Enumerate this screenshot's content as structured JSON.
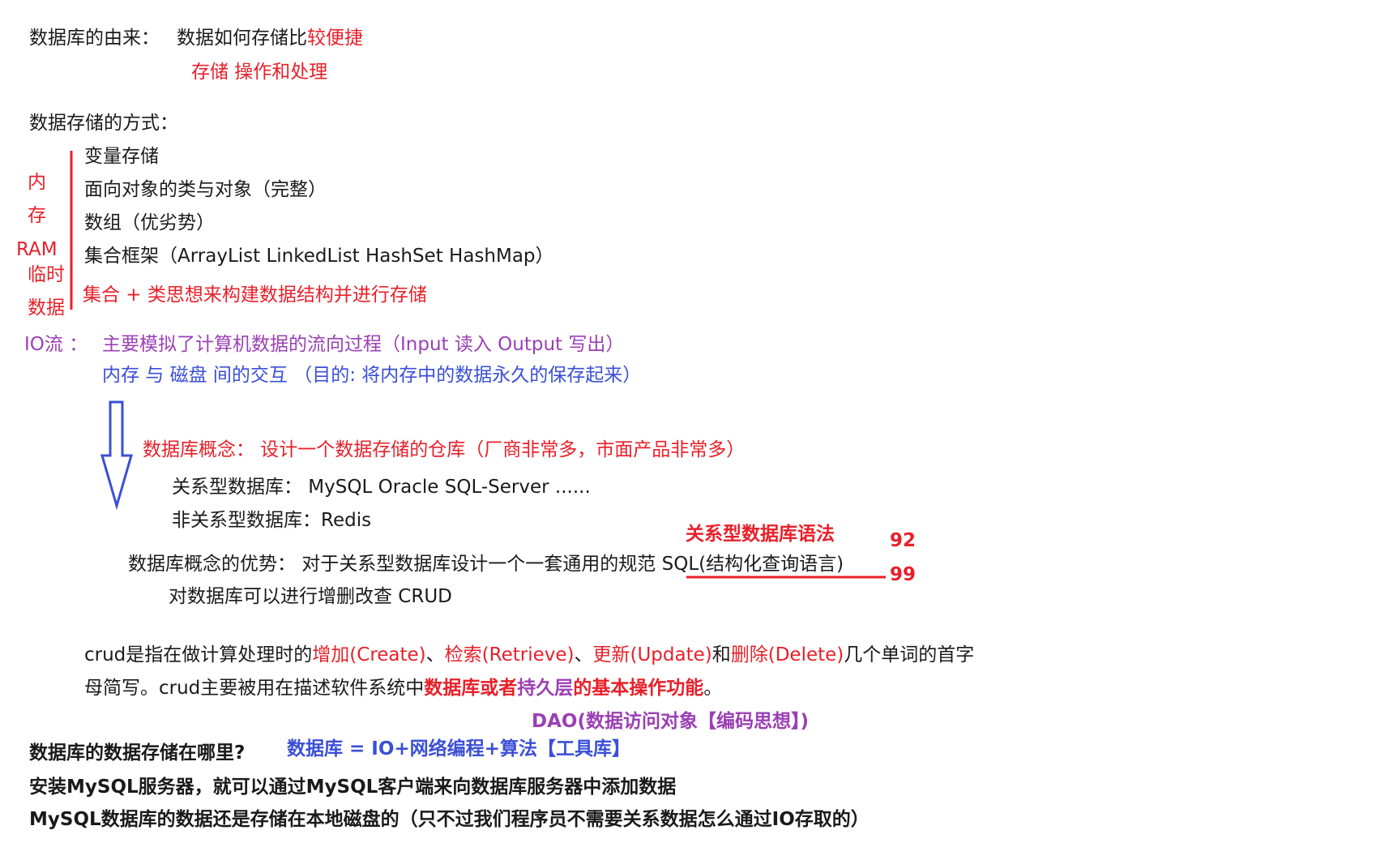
{
  "origin": {
    "label": "数据库的由来：",
    "text_black": "数据如何存储比",
    "text_red": "较便捷",
    "sub": "存储   操作和处理"
  },
  "storage": {
    "heading": "数据存储的方式：",
    "items": [
      "变量存储",
      "面向对象的类与对象（完整）",
      "数组（优劣势）",
      "集合框架（ArrayList LinkedList HashSet HashMap）"
    ],
    "summary": "集合 + 类思想来构建数据结构并进行存储",
    "side_labels": [
      "内",
      "存",
      "RAM",
      "临时",
      "数据"
    ]
  },
  "io": {
    "label": "IO流 ：",
    "line1": "主要模拟了计算机数据的流向过程（Input 读入   Output 写出）",
    "line2": "内存 与  磁盘  间的交互  （目的:   将内存中的数据永久的保存起来）"
  },
  "db_concept": {
    "line": "数据库概念：   设计一个数据存储的仓库（厂商非常多，市面产品非常多）",
    "relational": "关系型数据库：   MySQL  Oracle  SQL-Server ......",
    "nonrelational": "非关系型数据库：Redis"
  },
  "advantage": {
    "annotation": "关系型数据库语法",
    "num_top": "92",
    "num_bottom": "99",
    "text": "数据库概念的优势：   对于关系型数据库设计一个一套通用的规范 SQL(结构化查询语言)",
    "crud_line": "对数据库可以进行增删改查 CRUD"
  },
  "crud": {
    "line1_parts": [
      {
        "text": "crud是指在做计算处理时的",
        "color": "black"
      },
      {
        "text": "增加(Create)",
        "color": "red"
      },
      {
        "text": "、",
        "color": "black"
      },
      {
        "text": "检索(Retrieve)",
        "color": "red"
      },
      {
        "text": "、",
        "color": "black"
      },
      {
        "text": "更新(Update)",
        "color": "red"
      },
      {
        "text": "和",
        "color": "black"
      },
      {
        "text": "删除(Delete)",
        "color": "red"
      },
      {
        "text": "几个单词的首字",
        "color": "black"
      }
    ],
    "line2_parts": [
      {
        "text": "母简写。crud主要被用在描述软件系统中",
        "color": "black",
        "bold": false
      },
      {
        "text": "数据库或者",
        "color": "red",
        "bold": true
      },
      {
        "text": "持久层",
        "color": "purple",
        "bold": true
      },
      {
        "text": "的基本操作功能",
        "color": "red",
        "bold": true
      },
      {
        "text": "。",
        "color": "black",
        "bold": false
      }
    ]
  },
  "dao": "DAO(数据访问对象【编码思想】)",
  "where": {
    "question": "数据库的数据存储在哪里?",
    "formula": "数据库 = IO+网络编程+算法【工具库】",
    "install": "安装MySQL服务器，就可以通过MySQL客户端来向数据库服务器中添加数据",
    "local": "MySQL数据库的数据还是存储在本地磁盘的（只不过我们程序员不需要关系数据怎么通过IO存取的）"
  },
  "colors": {
    "red": "#e8202a",
    "purple": "#9b3fb5",
    "blue": "#3b4fd6",
    "black": "#1a1a1a"
  }
}
